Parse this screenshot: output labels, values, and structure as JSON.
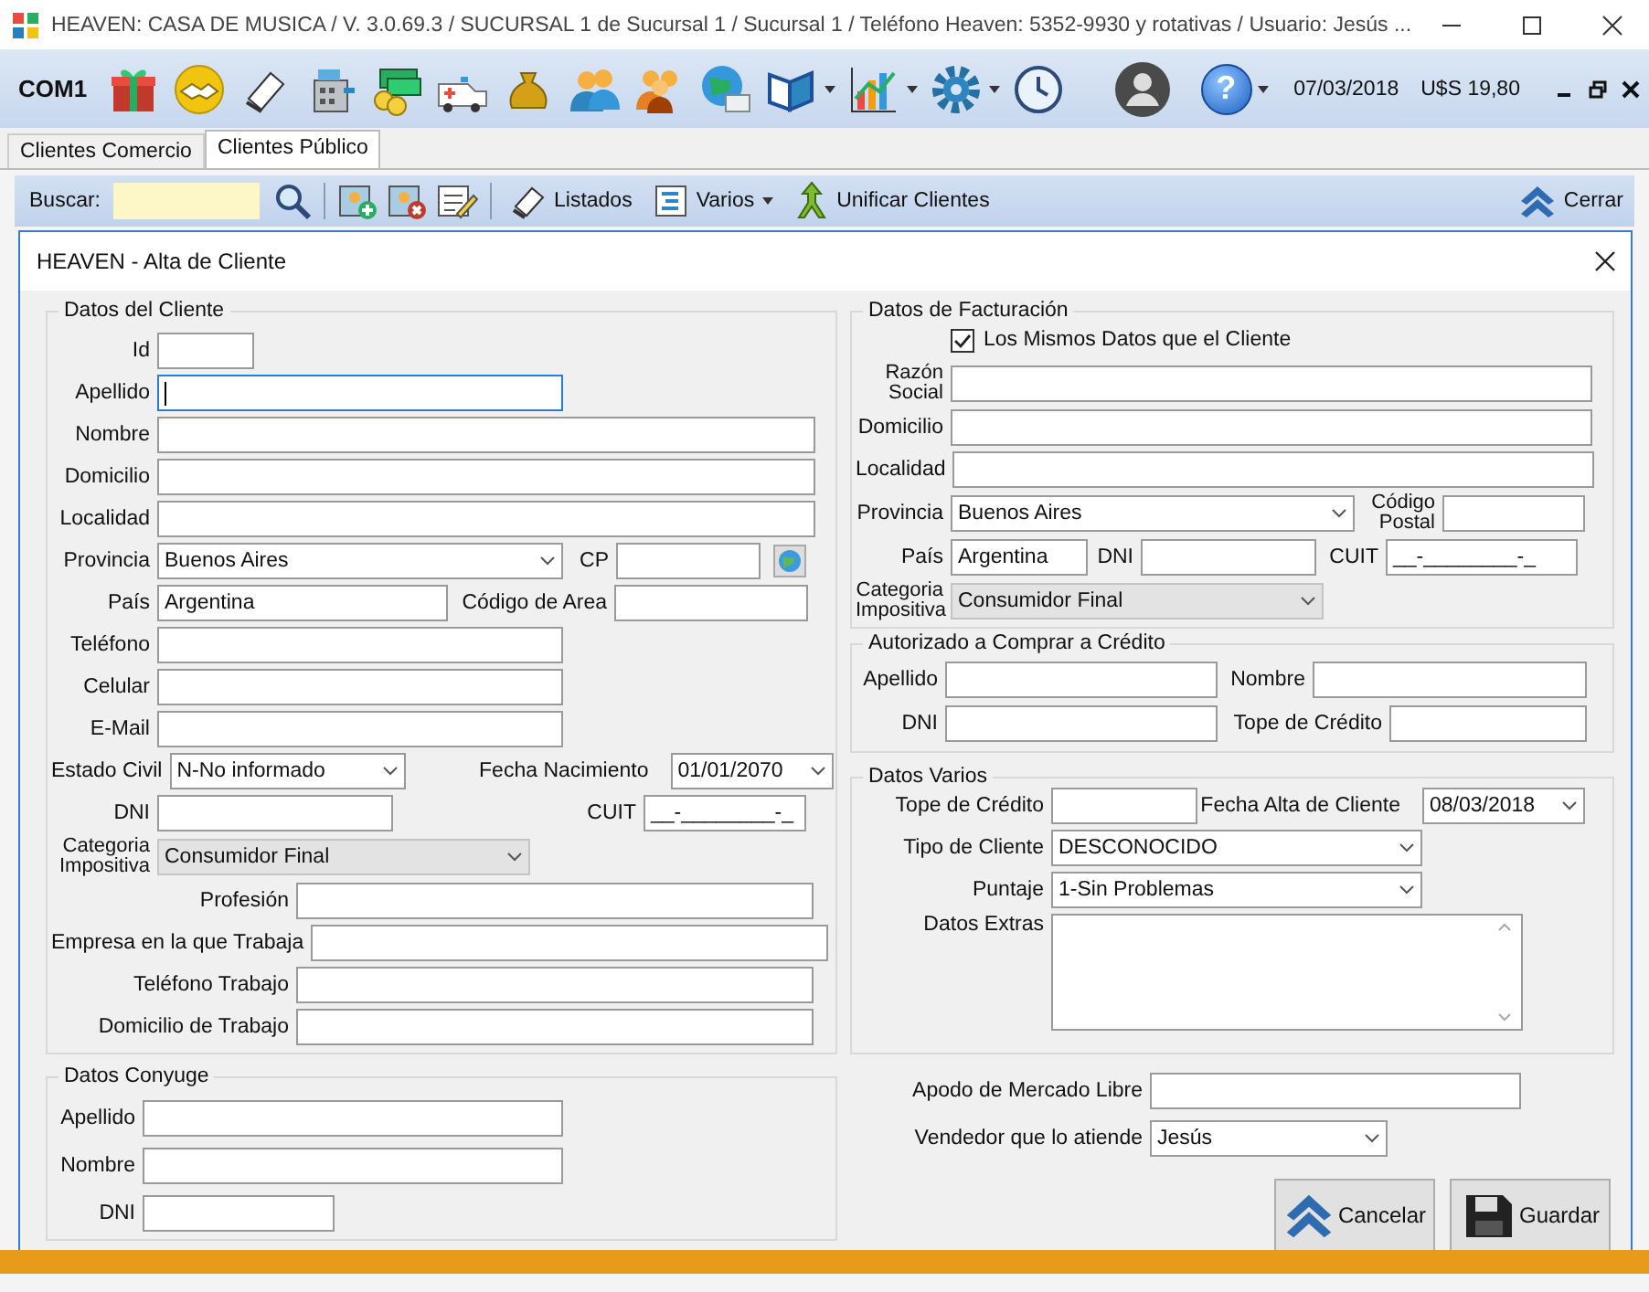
{
  "window": {
    "title": "HEAVEN: CASA DE MUSICA / V. 3.0.69.3 / SUCURSAL 1 de Sucursal 1 / Sucursal 1 / Teléfono Heaven: 5352-9930 y rotativas / Usuario: Jesús ..."
  },
  "toolbar": {
    "port": "COM1",
    "help": "?",
    "date": "07/03/2018",
    "rate": "U$S 19,80"
  },
  "tabs": [
    {
      "label": "Clientes Comercio",
      "selected": false
    },
    {
      "label": "Clientes Público",
      "selected": true
    }
  ],
  "search": {
    "label": "Buscar:"
  },
  "actions": [
    {
      "label": "Listados",
      "kind": "list"
    },
    {
      "label": "Varios",
      "kind": "menu"
    },
    {
      "label": "Unificar Clientes",
      "kind": "merge"
    }
  ],
  "close_button": "Cerrar",
  "dialog": {
    "title": "HEAVEN - Alta de Cliente",
    "left": [
      {
        "title": "Datos del Cliente",
        "rows": [
          [
            {
              "label": "Id",
              "kind": "text"
            }
          ],
          [
            {
              "label": "Apellido",
              "kind": "text",
              "focused": true
            }
          ],
          [
            {
              "label": "Nombre",
              "kind": "text"
            }
          ],
          [
            {
              "label": "Domicilio",
              "kind": "text"
            }
          ],
          [
            {
              "label": "Localidad",
              "kind": "text"
            }
          ],
          [
            {
              "label": "Provincia",
              "kind": "select",
              "value": "Buenos Aires"
            },
            {
              "label": "CP",
              "kind": "text"
            },
            {
              "kind": "icon_button"
            }
          ],
          [
            {
              "label": "País",
              "kind": "text",
              "value": "Argentina"
            },
            {
              "label": "Código de Area",
              "kind": "text"
            }
          ],
          [
            {
              "label": "Teléfono",
              "kind": "text"
            }
          ],
          [
            {
              "label": "Celular",
              "kind": "text"
            }
          ],
          [
            {
              "label": "E-Mail",
              "kind": "text"
            }
          ],
          [
            {
              "label": "Estado Civil",
              "kind": "select",
              "value": "N-No informado"
            },
            {
              "label": "Fecha Nacimiento",
              "kind": "date",
              "value": "01/01/2070"
            }
          ],
          [
            {
              "label": "DNI",
              "kind": "text"
            },
            {
              "label": "CUIT",
              "kind": "mask",
              "value": "__-________-_"
            }
          ],
          [
            {
              "label": "Categoria Impositiva",
              "kind": "select",
              "value": "Consumidor Final",
              "disabled": true
            }
          ],
          [
            {
              "label": "Profesión",
              "kind": "text"
            }
          ],
          [
            {
              "label": "Empresa en la que Trabaja",
              "kind": "text"
            }
          ],
          [
            {
              "label": "Teléfono Trabajo",
              "kind": "text"
            }
          ],
          [
            {
              "label": "Domicilio de Trabajo",
              "kind": "text"
            }
          ]
        ]
      },
      {
        "title": "Datos Conyuge",
        "rows": [
          [
            {
              "label": "Apellido",
              "kind": "text"
            }
          ],
          [
            {
              "label": "Nombre",
              "kind": "text"
            }
          ],
          [
            {
              "label": "DNI",
              "kind": "text"
            }
          ]
        ]
      }
    ],
    "right": [
      {
        "title": "Datos de Facturación",
        "rows": [
          [
            {
              "label": "Los Mismos Datos que el Cliente",
              "kind": "check",
              "checked": true
            }
          ],
          [
            {
              "label": "Razón Social",
              "kind": "text"
            }
          ],
          [
            {
              "label": "Domicilio",
              "kind": "text"
            }
          ],
          [
            {
              "label": "Localidad",
              "kind": "text"
            }
          ],
          [
            {
              "label": "Provincia",
              "kind": "select",
              "value": "Buenos Aires"
            },
            "",
            {
              "label": "Código Postal",
              "kind": "text"
            }
          ],
          [
            {
              "label": "País",
              "kind": "text",
              "value": "Argentina"
            },
            {
              "label": "DNI",
              "kind": "text"
            },
            {
              "label": "CUIT",
              "kind": "mask",
              "value": "__-________-_"
            }
          ],
          [
            {
              "label": "Categoria Impositiva",
              "kind": "select",
              "value": "Consumidor Final",
              "disabled": true
            }
          ]
        ]
      },
      {
        "title": "Autorizado a Comprar a Crédito",
        "rows": [
          [
            {
              "label": "Apellido",
              "kind": "text"
            },
            {
              "label": "Nombre",
              "kind": "text"
            }
          ],
          [
            {
              "label": "DNI",
              "kind": "text"
            },
            {
              "label": "Tope de Crédito",
              "kind": "text"
            }
          ]
        ]
      },
      {
        "title": "Datos Varios",
        "rows": [
          [
            {
              "label": "Tope de Crédito",
              "kind": "text"
            },
            {
              "label": "Fecha Alta de Cliente",
              "kind": "date",
              "value": "08/03/2018"
            }
          ],
          [
            {
              "label": "Tipo de Cliente",
              "kind": "select",
              "value": "DESCONOCIDO"
            }
          ],
          [
            {
              "label": "Puntaje",
              "kind": "select",
              "value": "1-Sin Problemas"
            }
          ],
          [
            {
              "label": "Datos Extras",
              "kind": "memo"
            }
          ]
        ]
      },
      {
        "rows": [
          [
            {
              "label": "Apodo de Mercado Libre",
              "kind": "text"
            }
          ],
          [
            {
              "label": "Vendedor que lo atiende",
              "kind": "select",
              "value": "Jesús"
            }
          ]
        ]
      }
    ],
    "buttons": [
      {
        "label": "Cancelar",
        "kind": "cancel"
      },
      {
        "label": "Guardar",
        "kind": "save"
      }
    ]
  }
}
